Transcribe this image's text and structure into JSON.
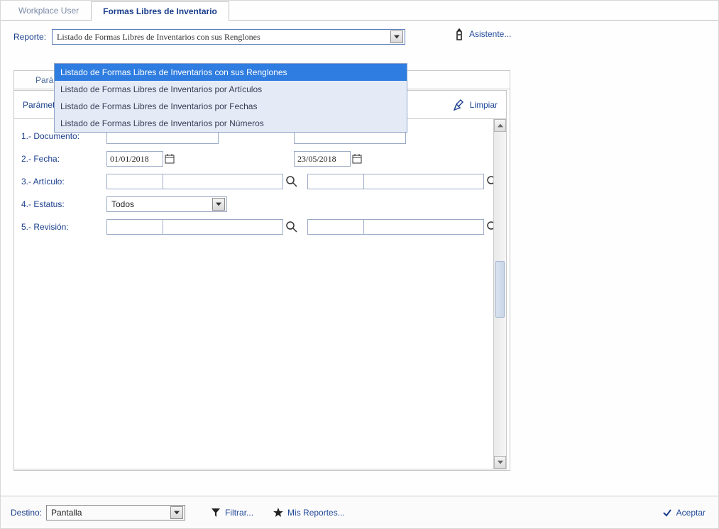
{
  "tabs": [
    "Workplace User",
    "Formas Libres de Inventario"
  ],
  "report": {
    "label": "Reporte:",
    "selected": "Listado de Formas Libres de Inventarios con sus Renglones",
    "options": [
      "Listado de Formas Libres de Inventarios con sus Renglones",
      "Listado de Formas Libres de Inventarios por Artículos",
      "Listado de Formas Libres de Inventarios por Fechas",
      "Listado de Formas Libres de Inventarios por Números"
    ]
  },
  "assistant": {
    "label": "Asistente..."
  },
  "inner_tab": {
    "visible": "Pará"
  },
  "panel": {
    "title_truncated": "Parámet",
    "clear": "Limpiar"
  },
  "form": {
    "rows": [
      {
        "label": "1.- Documento:",
        "from": "",
        "to": ""
      },
      {
        "label": "2.- Fecha:",
        "from": "01/01/2018",
        "to": "23/05/2018"
      },
      {
        "label": "3.- Artículo:"
      },
      {
        "label": "4.- Estatus:",
        "value": "Todos"
      },
      {
        "label": "5.- Revisión:"
      }
    ]
  },
  "footer": {
    "destino_label": "Destino:",
    "destino_value": "Pantalla",
    "filtrar": "Filtrar...",
    "mis_reportes": "Mis Reportes...",
    "aceptar": "Aceptar"
  }
}
